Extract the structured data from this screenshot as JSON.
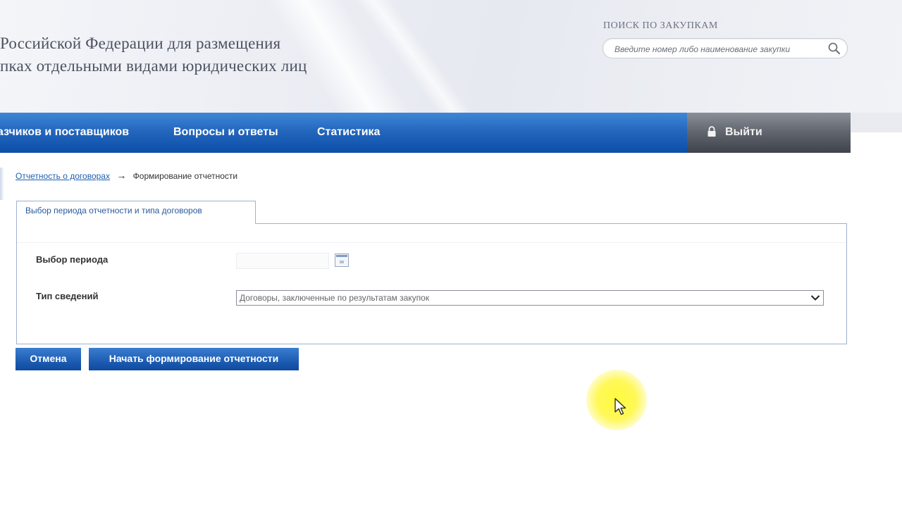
{
  "header": {
    "title_line1": "Российской Федерации для размещения",
    "title_line2": "пках отдельными видами юридических лиц",
    "search_label": "ПОИСК ПО ЗАКУПКАМ",
    "search_placeholder": "Введите номер либо наименование закупки",
    "search_icon": "search-icon"
  },
  "nav": {
    "items": [
      {
        "label": "азчиков и поставщиков"
      },
      {
        "label": "Вопросы и ответы"
      },
      {
        "label": "Статистика"
      }
    ],
    "login_label": "Выйти",
    "login_icon": "lock-icon"
  },
  "breadcrumb": {
    "link": "Отчетность о договорах",
    "separator": "→",
    "current": "Формирование отчетности"
  },
  "form": {
    "tab_label": "Выбор периода отчетности и типа договоров",
    "period_label": "Выбор периода",
    "period_value": "",
    "calendar_icon": "calendar-icon",
    "type_label": "Тип сведений",
    "type_selected": "Договоры, заключенные по результатам закупок"
  },
  "buttons": {
    "cancel": "Отмена",
    "start": "Начать формирование отчетности"
  },
  "colors": {
    "nav_blue": "#2467bd",
    "login_gray": "#5f646d",
    "button_blue": "#1f5fb5",
    "link_blue": "#1f5fae",
    "cursor_highlight": "#fff83c"
  }
}
